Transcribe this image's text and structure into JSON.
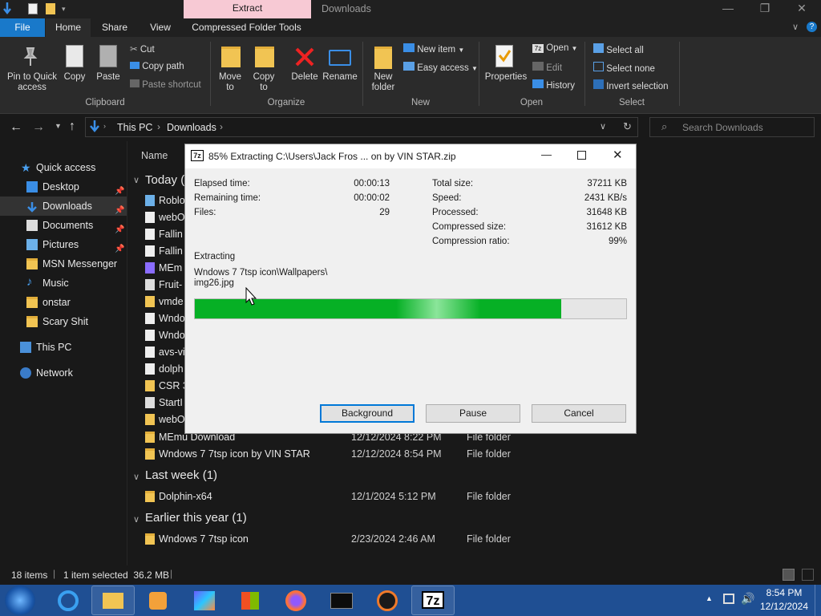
{
  "titlebar": {
    "extract_tab": "Extract",
    "window_title": "Downloads",
    "minimize": "—",
    "maximize": "❐",
    "close": "✕"
  },
  "tabs": {
    "file": "File",
    "home": "Home",
    "share": "Share",
    "view": "View",
    "compressed": "Compressed Folder Tools"
  },
  "ribbon": {
    "pin": "Pin to Quick access",
    "copy": "Copy",
    "paste": "Paste",
    "cut": "Cut",
    "copy_path": "Copy path",
    "paste_shortcut": "Paste shortcut",
    "group_clipboard": "Clipboard",
    "move_to": "Move to",
    "copy_to": "Copy to",
    "delete": "Delete",
    "rename": "Rename",
    "group_organize": "Organize",
    "new_folder": "New folder",
    "new_item": "New item",
    "easy_access": "Easy access",
    "group_new": "New",
    "properties": "Properties",
    "open": "Open",
    "edit": "Edit",
    "history": "History",
    "group_open": "Open",
    "select_all": "Select all",
    "select_none": "Select none",
    "invert_selection": "Invert selection",
    "group_select": "Select"
  },
  "address": {
    "this_pc": "This PC",
    "downloads": "Downloads",
    "search_placeholder": "Search Downloads"
  },
  "nav": {
    "quick_access": "Quick access",
    "desktop": "Desktop",
    "downloads": "Downloads",
    "documents": "Documents",
    "pictures": "Pictures",
    "msn": "MSN Messenger",
    "music": "Music",
    "onstar": "onstar",
    "scary": "Scary Shit",
    "this_pc": "This PC",
    "network": "Network"
  },
  "list": {
    "name_header": "Name",
    "group_today": "Today (",
    "today_items": [
      "Roblo",
      "webO",
      "Fallin",
      "Fallin",
      "MEm",
      "Fruit-",
      "vmde",
      "Wndo",
      "Wndo",
      "avs-vi",
      "dolph",
      "CSR 3",
      "StartI",
      "webO"
    ],
    "rows": [
      {
        "name": "MEmu Download",
        "date": "12/12/2024 8:22 PM",
        "type": "File folder"
      },
      {
        "name": "Wndows 7 7tsp icon by VIN STAR",
        "date": "12/12/2024 8:54 PM",
        "type": "File folder"
      }
    ],
    "group_lastweek": "Last week (1)",
    "lastweek_row": {
      "name": "Dolphin-x64",
      "date": "12/1/2024 5:12 PM",
      "type": "File folder"
    },
    "group_earlier": "Earlier this year (1)",
    "earlier_row": {
      "name": "Wndows 7 7tsp icon",
      "date": "2/23/2024 2:46 AM",
      "type": "File folder"
    }
  },
  "status": {
    "items": "18 items",
    "selected": "1 item selected  36.2 MB"
  },
  "taskbar": {
    "time": "8:54 PM",
    "date": "12/12/2024",
    "sevenzip_label": "7z"
  },
  "dialog": {
    "icon_label": "7z",
    "title": "85% Extracting C:\\Users\\Jack Fros ... on by VIN STAR.zip",
    "elapsed_label": "Elapsed time:",
    "elapsed": "00:00:13",
    "remaining_label": "Remaining time:",
    "remaining": "00:00:02",
    "files_label": "Files:",
    "files": "29",
    "total_label": "Total size:",
    "total": "37211 KB",
    "speed_label": "Speed:",
    "speed": "2431 KB/s",
    "processed_label": "Processed:",
    "processed": "31648 KB",
    "compressed_label": "Compressed size:",
    "compressed": "31612 KB",
    "ratio_label": "Compression ratio:",
    "ratio": "99%",
    "extracting_label": "Extracting",
    "path_line1": "Wndows 7 7tsp icon\\Wallpapers\\",
    "path_line2": "img26.jpg",
    "progress": 0.85,
    "background_btn": "Background",
    "pause_btn": "Pause",
    "cancel_btn": "Cancel"
  }
}
